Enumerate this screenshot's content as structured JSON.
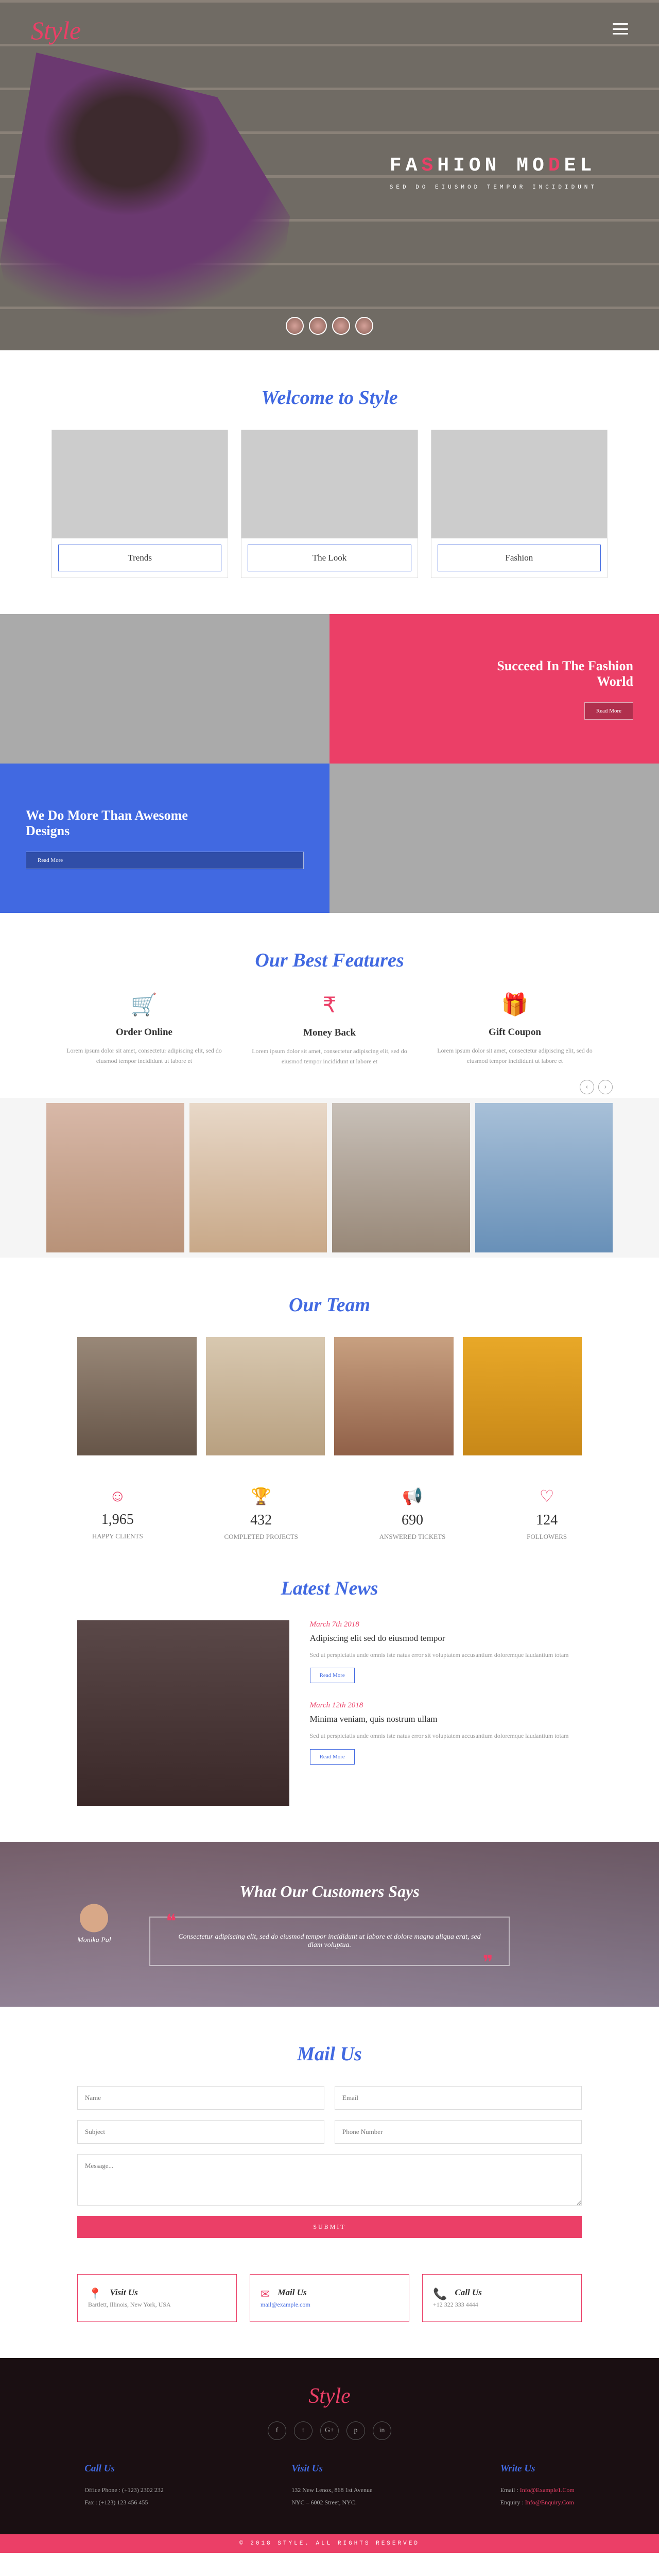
{
  "logo": "Style",
  "hero": {
    "title_white1": "FA",
    "title_red1": "S",
    "title_white2": "HION MO",
    "title_red2": "D",
    "title_white3": "EL",
    "subtitle": "sed do eiusmod tempor incididunt"
  },
  "welcome": {
    "title": "Welcome to Style",
    "cards": [
      "Trends",
      "The Look",
      "Fashion"
    ]
  },
  "tiles": {
    "t2": "Succeed In The Fashion World",
    "t3": "We Do More Than Awesome Designs",
    "btn": "Read More"
  },
  "features": {
    "title": "Our Best Features",
    "items": [
      {
        "icon": "🛒",
        "title": "Order Online"
      },
      {
        "icon": "₹",
        "title": "Money Back"
      },
      {
        "icon": "🎁",
        "title": "Gift Coupon"
      }
    ],
    "desc": "Lorem ipsum dolor sit amet, consectetur adipiscing elit, sed do eiusmod tempor incididunt ut labore et"
  },
  "team": {
    "title": "Our Team"
  },
  "stats": [
    {
      "icon": "☺",
      "n": "1,965",
      "l": "HAPPY CLIENTS"
    },
    {
      "icon": "🏆",
      "n": "432",
      "l": "COMPLETED PROJECTS"
    },
    {
      "icon": "📢",
      "n": "690",
      "l": "ANSWERED TICKETS"
    },
    {
      "icon": "♡",
      "n": "124",
      "l": "FOLLOWERS"
    }
  ],
  "news": {
    "title": "Latest News",
    "items": [
      {
        "date": "March 7th 2018",
        "title": "Adipiscing elit sed do eiusmod tempor"
      },
      {
        "date": "March 12th 2018",
        "title": "Minima veniam, quis nostrum ullam"
      }
    ],
    "desc": "Sed ut perspiciatis unde omnis iste natus error sit voluptatem accusantium doloremque laudantium totam",
    "more": "Read More"
  },
  "testi": {
    "title": "What Our Customers Says",
    "quote": "Consectetur adipiscing elit, sed do eiusmod tempor incididunt ut labore et dolore magna aliqua erat, sed diam voluptua.",
    "author": "Monika Pal"
  },
  "mail": {
    "title": "Mail Us",
    "ph": {
      "name": "Name",
      "email": "Email",
      "subject": "Subject",
      "phone": "Phone Number",
      "msg": "Message..."
    },
    "submit": "SUBMIT"
  },
  "cboxes": [
    {
      "icon": "📍",
      "title": "Visit Us",
      "text": "Bartlett, Illinois, New York, USA"
    },
    {
      "icon": "✉",
      "title": "Mail Us",
      "text": "mail@example.com"
    },
    {
      "icon": "📞",
      "title": "Call Us",
      "text": "+12 322 333 4444"
    }
  ],
  "footer": {
    "call": {
      "title": "Call Us",
      "l1": "Office Phone : (+123) 2302 232",
      "l2": "Fax : (+123) 123 456 455"
    },
    "visit": {
      "title": "Visit Us",
      "l1": "132 New Lenox, 868 1st Avenue",
      "l2": "NYC – 6002 Street, NYC."
    },
    "write": {
      "title": "Write Us",
      "l1": "Email : ",
      "e1": "Info@Example1.Com",
      "l2": "Enquiry : ",
      "e2": "Info@Enquiry.Com"
    },
    "copy": "© 2018 STYLE. ALL RIGHTS RESERVED"
  }
}
